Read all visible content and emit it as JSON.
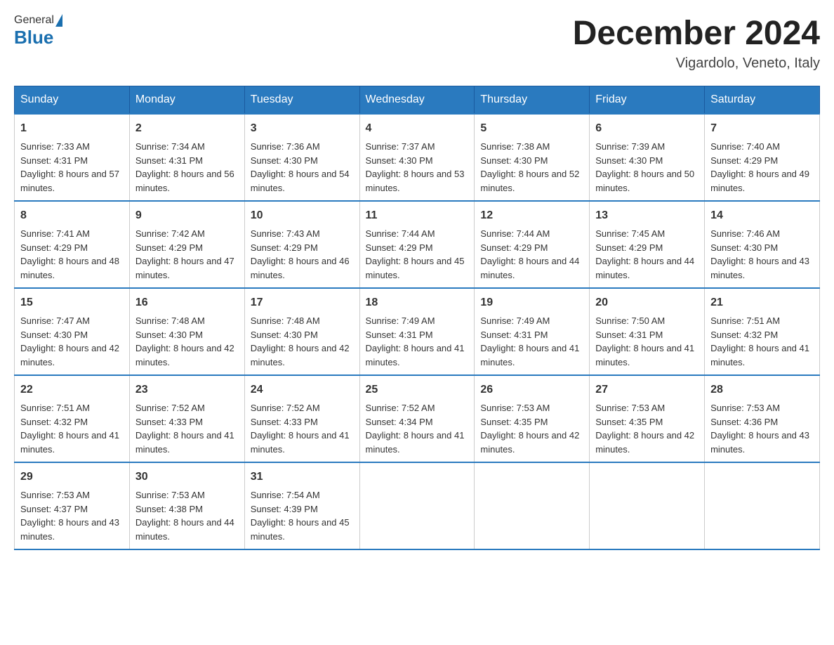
{
  "header": {
    "logo_general": "General",
    "logo_blue": "Blue",
    "month_title": "December 2024",
    "location": "Vigardolo, Veneto, Italy"
  },
  "days_of_week": [
    "Sunday",
    "Monday",
    "Tuesday",
    "Wednesday",
    "Thursday",
    "Friday",
    "Saturday"
  ],
  "weeks": [
    [
      {
        "day": "1",
        "sunrise": "7:33 AM",
        "sunset": "4:31 PM",
        "daylight": "8 hours and 57 minutes."
      },
      {
        "day": "2",
        "sunrise": "7:34 AM",
        "sunset": "4:31 PM",
        "daylight": "8 hours and 56 minutes."
      },
      {
        "day": "3",
        "sunrise": "7:36 AM",
        "sunset": "4:30 PM",
        "daylight": "8 hours and 54 minutes."
      },
      {
        "day": "4",
        "sunrise": "7:37 AM",
        "sunset": "4:30 PM",
        "daylight": "8 hours and 53 minutes."
      },
      {
        "day": "5",
        "sunrise": "7:38 AM",
        "sunset": "4:30 PM",
        "daylight": "8 hours and 52 minutes."
      },
      {
        "day": "6",
        "sunrise": "7:39 AM",
        "sunset": "4:30 PM",
        "daylight": "8 hours and 50 minutes."
      },
      {
        "day": "7",
        "sunrise": "7:40 AM",
        "sunset": "4:29 PM",
        "daylight": "8 hours and 49 minutes."
      }
    ],
    [
      {
        "day": "8",
        "sunrise": "7:41 AM",
        "sunset": "4:29 PM",
        "daylight": "8 hours and 48 minutes."
      },
      {
        "day": "9",
        "sunrise": "7:42 AM",
        "sunset": "4:29 PM",
        "daylight": "8 hours and 47 minutes."
      },
      {
        "day": "10",
        "sunrise": "7:43 AM",
        "sunset": "4:29 PM",
        "daylight": "8 hours and 46 minutes."
      },
      {
        "day": "11",
        "sunrise": "7:44 AM",
        "sunset": "4:29 PM",
        "daylight": "8 hours and 45 minutes."
      },
      {
        "day": "12",
        "sunrise": "7:44 AM",
        "sunset": "4:29 PM",
        "daylight": "8 hours and 44 minutes."
      },
      {
        "day": "13",
        "sunrise": "7:45 AM",
        "sunset": "4:29 PM",
        "daylight": "8 hours and 44 minutes."
      },
      {
        "day": "14",
        "sunrise": "7:46 AM",
        "sunset": "4:30 PM",
        "daylight": "8 hours and 43 minutes."
      }
    ],
    [
      {
        "day": "15",
        "sunrise": "7:47 AM",
        "sunset": "4:30 PM",
        "daylight": "8 hours and 42 minutes."
      },
      {
        "day": "16",
        "sunrise": "7:48 AM",
        "sunset": "4:30 PM",
        "daylight": "8 hours and 42 minutes."
      },
      {
        "day": "17",
        "sunrise": "7:48 AM",
        "sunset": "4:30 PM",
        "daylight": "8 hours and 42 minutes."
      },
      {
        "day": "18",
        "sunrise": "7:49 AM",
        "sunset": "4:31 PM",
        "daylight": "8 hours and 41 minutes."
      },
      {
        "day": "19",
        "sunrise": "7:49 AM",
        "sunset": "4:31 PM",
        "daylight": "8 hours and 41 minutes."
      },
      {
        "day": "20",
        "sunrise": "7:50 AM",
        "sunset": "4:31 PM",
        "daylight": "8 hours and 41 minutes."
      },
      {
        "day": "21",
        "sunrise": "7:51 AM",
        "sunset": "4:32 PM",
        "daylight": "8 hours and 41 minutes."
      }
    ],
    [
      {
        "day": "22",
        "sunrise": "7:51 AM",
        "sunset": "4:32 PM",
        "daylight": "8 hours and 41 minutes."
      },
      {
        "day": "23",
        "sunrise": "7:52 AM",
        "sunset": "4:33 PM",
        "daylight": "8 hours and 41 minutes."
      },
      {
        "day": "24",
        "sunrise": "7:52 AM",
        "sunset": "4:33 PM",
        "daylight": "8 hours and 41 minutes."
      },
      {
        "day": "25",
        "sunrise": "7:52 AM",
        "sunset": "4:34 PM",
        "daylight": "8 hours and 41 minutes."
      },
      {
        "day": "26",
        "sunrise": "7:53 AM",
        "sunset": "4:35 PM",
        "daylight": "8 hours and 42 minutes."
      },
      {
        "day": "27",
        "sunrise": "7:53 AM",
        "sunset": "4:35 PM",
        "daylight": "8 hours and 42 minutes."
      },
      {
        "day": "28",
        "sunrise": "7:53 AM",
        "sunset": "4:36 PM",
        "daylight": "8 hours and 43 minutes."
      }
    ],
    [
      {
        "day": "29",
        "sunrise": "7:53 AM",
        "sunset": "4:37 PM",
        "daylight": "8 hours and 43 minutes."
      },
      {
        "day": "30",
        "sunrise": "7:53 AM",
        "sunset": "4:38 PM",
        "daylight": "8 hours and 44 minutes."
      },
      {
        "day": "31",
        "sunrise": "7:54 AM",
        "sunset": "4:39 PM",
        "daylight": "8 hours and 45 minutes."
      },
      null,
      null,
      null,
      null
    ]
  ],
  "labels": {
    "sunrise_prefix": "Sunrise: ",
    "sunset_prefix": "Sunset: ",
    "daylight_prefix": "Daylight: "
  }
}
